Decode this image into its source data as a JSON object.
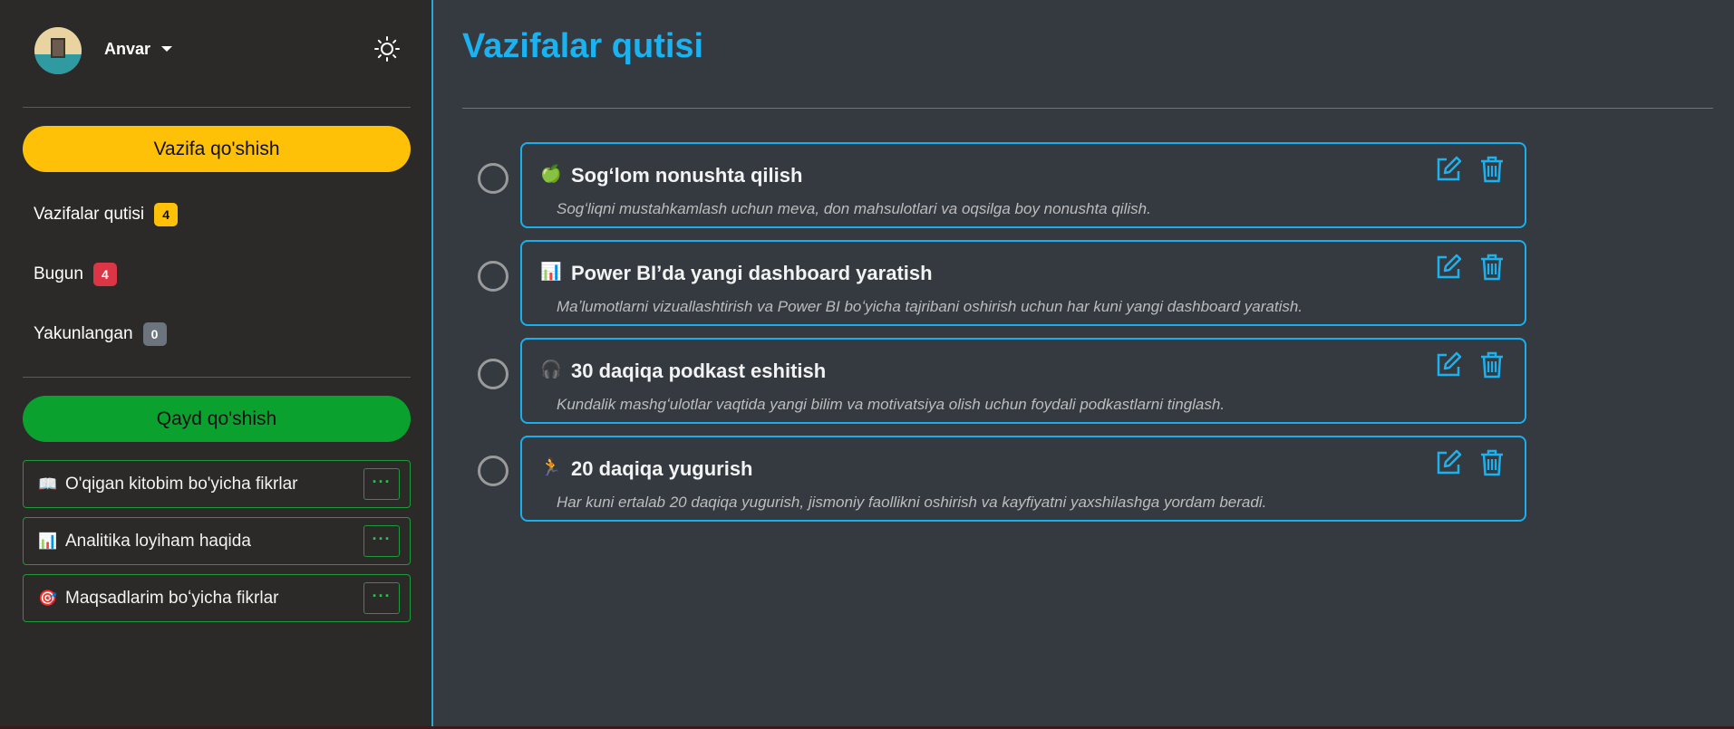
{
  "sidebar": {
    "profile": {
      "username": "Anvar",
      "theme_toggle": "sun-icon"
    },
    "add_task_label": "Vazifa qo'shish",
    "nav": [
      {
        "label": "Vazifalar qutisi",
        "count": "4",
        "badge_color": "#ffc107"
      },
      {
        "label": "Bugun",
        "count": "4",
        "badge_color": "#dc3545"
      },
      {
        "label": "Yakunlangan",
        "count": "0",
        "badge_color": "#6c757d"
      }
    ],
    "add_note_label": "Qayd qo'shish",
    "notes": [
      {
        "icon": "📖",
        "text": "O'qigan kitobim bo'yicha fikrlar",
        "more": "···"
      },
      {
        "icon": "📊",
        "text": "Analitika loyiham haqida",
        "more": "···"
      },
      {
        "icon": "🎯",
        "text": "Maqsadlarim boʻyicha fikrlar",
        "more": "···"
      }
    ]
  },
  "main": {
    "title": "Vazifalar qutisi",
    "tasks": [
      {
        "icon": "🍏",
        "title": "Sogʻlom nonushta qilish",
        "description": "Sogʻliqni mustahkamlash uchun meva, don mahsulotlari va oqsilga boy nonushta qilish."
      },
      {
        "icon": "📊",
        "title": "Power BI’da yangi dashboard yaratish",
        "description": "Maʼlumotlarni vizuallashtirish va Power BI boʻyicha tajribani oshirish uchun har kuni yangi dashboard yaratish."
      },
      {
        "icon": "🎧",
        "title": "30 daqiqa podkast eshitish",
        "description": "Kundalik mashgʻulotlar vaqtida yangi bilim va motivatsiya olish uchun foydali podkastlarni tinglash."
      },
      {
        "icon": "🏃",
        "title": "20 daqiqa yugurish",
        "description": "Har kuni ertalab 20 daqiqa yugurish, jismoniy faollikni oshirish va kayfiyatni yaxshilashga yordam beradi."
      }
    ]
  },
  "colors": {
    "accent": "#1ab2f0",
    "warning": "#ffc107",
    "success": "#0aa12f",
    "danger": "#dc3545"
  }
}
